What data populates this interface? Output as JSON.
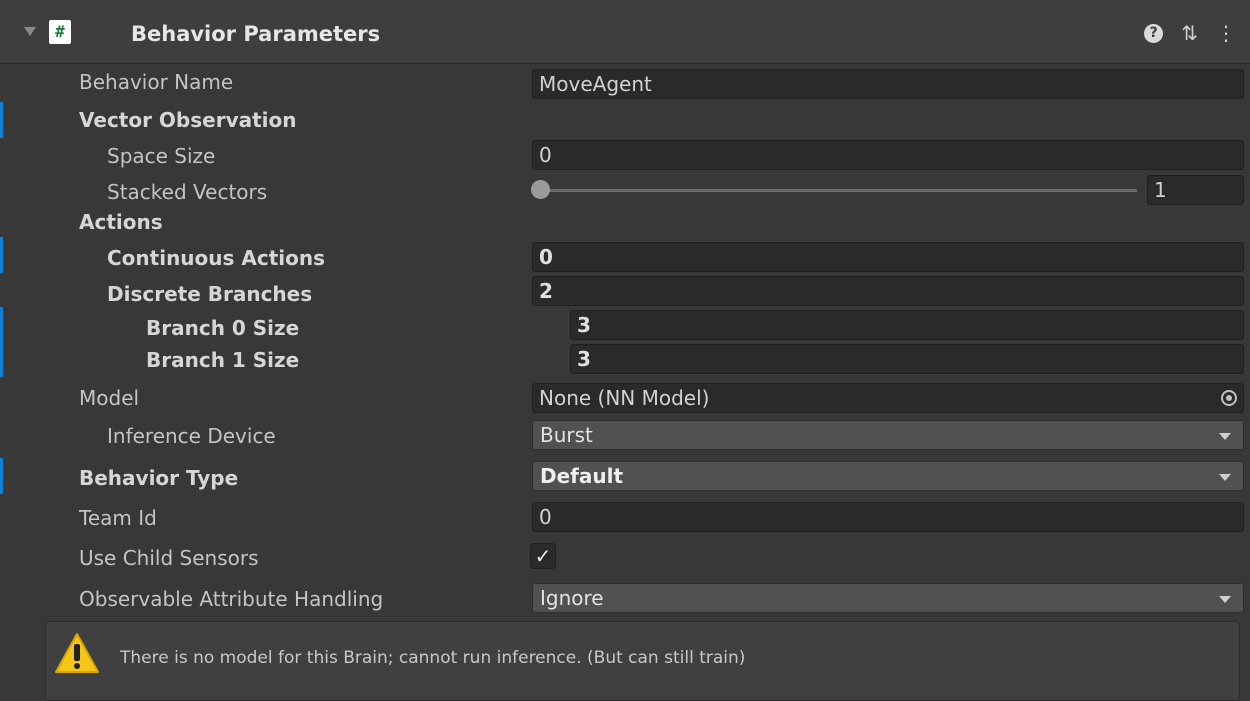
{
  "header": {
    "title": "Behavior Parameters",
    "script_icon": "hash-script-icon",
    "icons": [
      "help-icon",
      "presets-icon",
      "kebab-menu-icon"
    ]
  },
  "fields": {
    "behavior_name": {
      "label": "Behavior Name",
      "value": "MoveAgent"
    },
    "vector_observation": {
      "label": "Vector Observation"
    },
    "space_size": {
      "label": "Space Size",
      "value": "0"
    },
    "stacked_vectors": {
      "label": "Stacked Vectors",
      "value": "1"
    },
    "actions": {
      "label": "Actions"
    },
    "continuous_actions": {
      "label": "Continuous Actions",
      "value": "0"
    },
    "discrete_branches": {
      "label": "Discrete Branches",
      "value": "2"
    },
    "branch0": {
      "label": "Branch 0 Size",
      "value": "3"
    },
    "branch1": {
      "label": "Branch 1 Size",
      "value": "3"
    },
    "model": {
      "label": "Model",
      "value": "None (NN Model)"
    },
    "inference_device": {
      "label": "Inference Device",
      "value": "Burst"
    },
    "behavior_type": {
      "label": "Behavior Type",
      "value": "Default"
    },
    "team_id": {
      "label": "Team Id",
      "value": "0"
    },
    "use_child_sensors": {
      "label": "Use Child Sensors",
      "checked": true,
      "check_glyph": "✓"
    },
    "observable_attribute_handling": {
      "label": "Observable Attribute Handling",
      "value": "Ignore"
    }
  },
  "helpbox": {
    "icon": "warning-icon",
    "text": "There is no model for this Brain; cannot run inference. (But can still train)"
  },
  "colors": {
    "accent_mark": "#0f7fd7",
    "warning": "#f5c518"
  }
}
